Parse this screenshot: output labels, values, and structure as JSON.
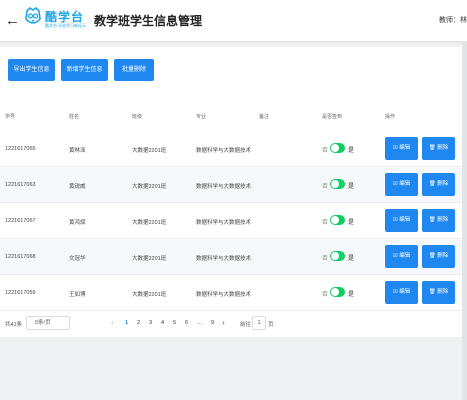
{
  "header": {
    "back_icon": "←",
    "logo_name": "酷学台",
    "logo_sub": "酷学台 开启学习新纪元",
    "logo_icon": "owl-icon",
    "title": "教学班学生信息管理",
    "user": "教师：林"
  },
  "toolbar": {
    "import_label": "导出学生信息",
    "add_label": "新增学生信息",
    "batch_delete_label": "批量删除"
  },
  "table": {
    "headers": [
      "学号",
      "姓名",
      "班级",
      "专业",
      "备注",
      "是否签到",
      "操作"
    ],
    "switch_off_label": "否",
    "switch_on_label": "是",
    "edit_label": "☑ 编辑",
    "delete_label": "🗑 删除",
    "rows": [
      {
        "id": "1221617065",
        "name": "黄林泽",
        "class": "大数据2201班",
        "major": "数据科学与大数据技术",
        "note": "",
        "checked_in": true
      },
      {
        "id": "1221617063",
        "name": "黄锐威",
        "class": "大数据2201班",
        "major": "数据科学与大数据技术",
        "note": "",
        "checked_in": true
      },
      {
        "id": "1221617067",
        "name": "黄鸿斌",
        "class": "大数据2201班",
        "major": "数据科学与大数据技术",
        "note": "",
        "checked_in": true
      },
      {
        "id": "1221617068",
        "name": "文冠华",
        "class": "大数据2201班",
        "major": "数据科学与大数据技术",
        "note": "",
        "checked_in": true
      },
      {
        "id": "1221617059",
        "name": "王如博",
        "class": "大数据2201班",
        "major": "数据科学与大数据技术",
        "note": "",
        "checked_in": true
      }
    ]
  },
  "pagination": {
    "total": "共41条",
    "page_size": "5条/页",
    "prev": "‹",
    "pages": [
      "1",
      "2",
      "3",
      "4",
      "5",
      "6",
      "…",
      "9"
    ],
    "active_page": "1",
    "next": "›",
    "goto_label": "前往",
    "goto_value": "1",
    "page_suffix": "页"
  },
  "colors": {
    "primary": "#1e88f0",
    "switch_on": "#13ce66",
    "logo": "#1ba5e4"
  }
}
